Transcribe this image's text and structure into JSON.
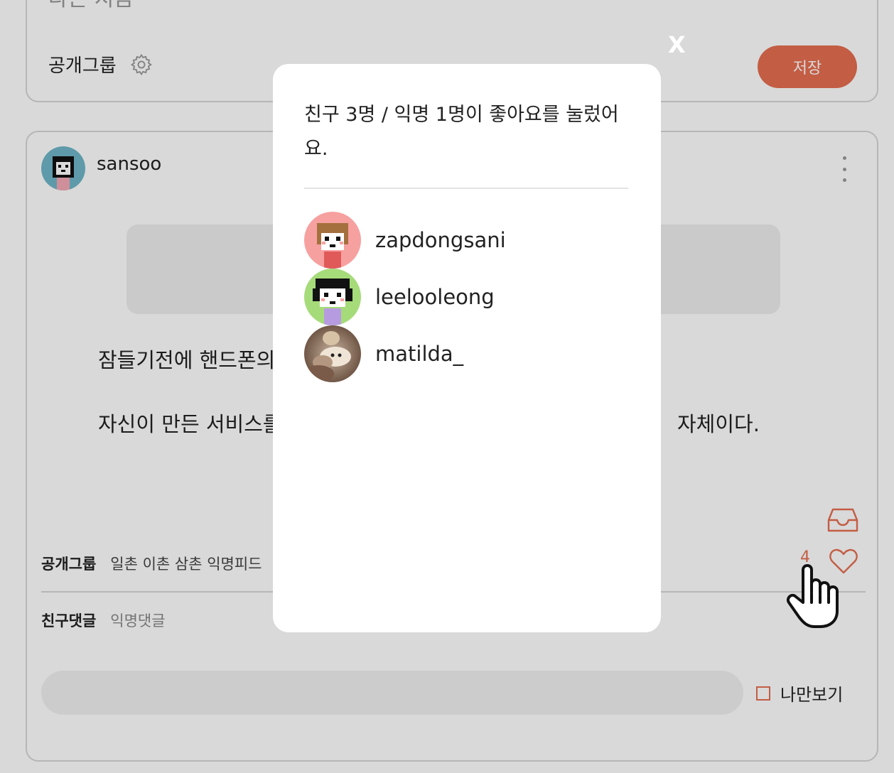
{
  "top_card": {
    "prev_text": "다른 지금",
    "group_label": "공개그룹",
    "save_label": "저장"
  },
  "post": {
    "username": "sansoo",
    "body_line1": "잠들기전에 핸드폰의",
    "body_line2": "자신이 만든 서비스를",
    "body_line2_tail": "자체이다.",
    "like_count": "4",
    "group_label": "공개그룹",
    "group_value": "일촌 이촌 삼촌 익명피드",
    "comment_tab_friend": "친구댓글",
    "comment_tab_anon": "익명댓글",
    "private_label": "나만보기"
  },
  "modal": {
    "close_label": "X",
    "title": "친구 3명 / 익명 1명이 좋아요를 눌렀어요.",
    "likers": [
      {
        "name": "zapdongsani"
      },
      {
        "name": "leelooleong"
      },
      {
        "name": "matilda_"
      }
    ]
  },
  "colors": {
    "accent": "#e66e50",
    "overlay": "rgba(0,0,0,0.15)"
  }
}
